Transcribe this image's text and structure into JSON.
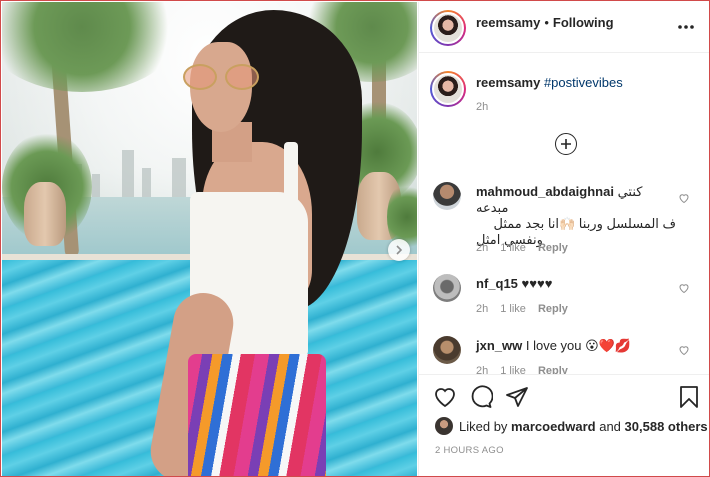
{
  "header": {
    "username": "reemsamy",
    "separator": "•",
    "follow_status": "Following",
    "more_icon": "more-horizontal-icon"
  },
  "caption": {
    "username": "reemsamy",
    "hashtag": "#postivevibes",
    "time": "2h"
  },
  "load_more_icon": "plus-circle-icon",
  "comments": [
    {
      "username": "mahmoud_abdaighnai",
      "text_line1": "كنتي مبدعه",
      "text_line2": "ف المسلسل وربنا 🙌🏻انا بجد ممثل",
      "text_line3": "ونفسي امثل",
      "time": "2h",
      "likes": "1 like",
      "reply": "Reply"
    },
    {
      "username": "nf_q15",
      "text": "♥♥♥♥",
      "time": "2h",
      "likes": "1 like",
      "reply": "Reply"
    },
    {
      "username": "jxn_ww",
      "text": "I love you 😮❤️💋",
      "time": "2h",
      "likes": "1 like",
      "reply": "Reply"
    }
  ],
  "actions": {
    "like_icon": "heart-icon",
    "comment_icon": "comment-icon",
    "share_icon": "share-icon",
    "save_icon": "bookmark-icon"
  },
  "likes": {
    "prefix": "Liked by",
    "user": "marcoedward",
    "and": "and",
    "count": "30,588 others"
  },
  "timestamp": "2 HOURS AGO",
  "colors": {
    "text": "#262626",
    "muted": "#8e8e8e",
    "link": "#00376b",
    "border": "#efefef"
  }
}
